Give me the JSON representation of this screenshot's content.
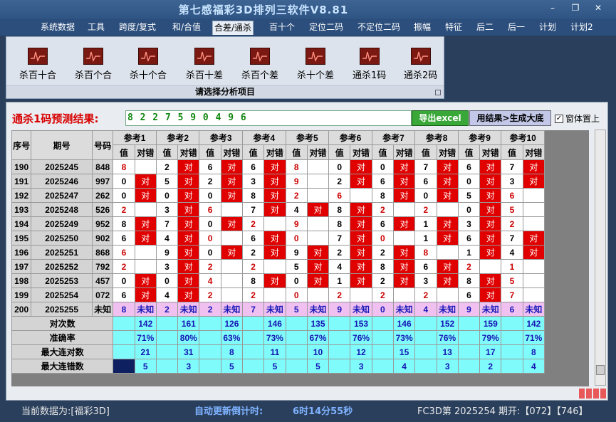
{
  "app": {
    "title": "第七感福彩3D排列三软件V8.81"
  },
  "menu": [
    "系统数据",
    "工具",
    "跨度/复式",
    "和/合值",
    "合差/通杀",
    "百十个",
    "定位二码",
    "不定位二码",
    "振幅",
    "特征",
    "后二",
    "后一",
    "计划",
    "计划2"
  ],
  "ribbon": {
    "buttons": [
      "杀百十合",
      "杀百个合",
      "杀十个合",
      "杀百十差",
      "杀百个差",
      "杀十个差",
      "通杀1码",
      "通杀2码"
    ],
    "footer": "请选择分析项目"
  },
  "prediction": {
    "label": "通杀1码预测结果:",
    "value": "8 2 2 7 5 9 0 4 9 6",
    "excel_button": "导出excel",
    "generate_button": "用结果>生成大底",
    "topmost_label": "窗体置上",
    "topmost_checked": true
  },
  "table": {
    "headers": {
      "seq": "序号",
      "period": "期号",
      "number": "号码",
      "refs": [
        "参考1",
        "参考2",
        "参考3",
        "参考4",
        "参考5",
        "参考6",
        "参考7",
        "参考8",
        "参考9",
        "参考10"
      ],
      "val": "值",
      "cmp": "对错"
    },
    "hit_label": "对",
    "rows": [
      {
        "seq": "190",
        "period": "2025245",
        "number": "848",
        "cells": [
          [
            "8",
            0
          ],
          [
            "2",
            1
          ],
          [
            "6",
            1
          ],
          [
            "6",
            1
          ],
          [
            "8",
            0
          ],
          [
            "0",
            1
          ],
          [
            "0",
            1
          ],
          [
            "7",
            1
          ],
          [
            "6",
            1
          ],
          [
            "7",
            1
          ]
        ]
      },
      {
        "seq": "191",
        "period": "2025246",
        "number": "997",
        "cells": [
          [
            "0",
            1
          ],
          [
            "5",
            1
          ],
          [
            "2",
            1
          ],
          [
            "3",
            1
          ],
          [
            "9",
            0
          ],
          [
            "2",
            1
          ],
          [
            "6",
            1
          ],
          [
            "6",
            1
          ],
          [
            "0",
            1
          ],
          [
            "3",
            1
          ]
        ]
      },
      {
        "seq": "192",
        "period": "2025247",
        "number": "262",
        "cells": [
          [
            "0",
            1
          ],
          [
            "0",
            1
          ],
          [
            "0",
            1
          ],
          [
            "8",
            1
          ],
          [
            "2",
            0
          ],
          [
            "6",
            0
          ],
          [
            "8",
            1
          ],
          [
            "0",
            1
          ],
          [
            "5",
            1
          ],
          [
            "6",
            0
          ]
        ]
      },
      {
        "seq": "193",
        "period": "2025248",
        "number": "526",
        "cells": [
          [
            "2",
            0
          ],
          [
            "3",
            1
          ],
          [
            "6",
            0
          ],
          [
            "7",
            1
          ],
          [
            "4",
            1
          ],
          [
            "8",
            1
          ],
          [
            "2",
            0
          ],
          [
            "2",
            0
          ],
          [
            "0",
            1
          ],
          [
            "5",
            0
          ]
        ]
      },
      {
        "seq": "194",
        "period": "2025249",
        "number": "952",
        "cells": [
          [
            "8",
            1
          ],
          [
            "7",
            1
          ],
          [
            "0",
            1
          ],
          [
            "2",
            0
          ],
          [
            "9",
            0
          ],
          [
            "8",
            1
          ],
          [
            "6",
            1
          ],
          [
            "1",
            1
          ],
          [
            "3",
            1
          ],
          [
            "2",
            0
          ]
        ]
      },
      {
        "seq": "195",
        "period": "2025250",
        "number": "902",
        "cells": [
          [
            "6",
            1
          ],
          [
            "4",
            1
          ],
          [
            "0",
            0
          ],
          [
            "6",
            1
          ],
          [
            "0",
            0
          ],
          [
            "7",
            1
          ],
          [
            "0",
            0
          ],
          [
            "1",
            1
          ],
          [
            "6",
            1
          ],
          [
            "7",
            1
          ]
        ]
      },
      {
        "seq": "196",
        "period": "2025251",
        "number": "868",
        "cells": [
          [
            "6",
            0
          ],
          [
            "9",
            1
          ],
          [
            "0",
            1
          ],
          [
            "2",
            1
          ],
          [
            "9",
            1
          ],
          [
            "2",
            1
          ],
          [
            "2",
            1
          ],
          [
            "8",
            0
          ],
          [
            "1",
            1
          ],
          [
            "4",
            1
          ]
        ]
      },
      {
        "seq": "197",
        "period": "2025252",
        "number": "792",
        "cells": [
          [
            "2",
            0
          ],
          [
            "3",
            1
          ],
          [
            "2",
            0
          ],
          [
            "2",
            0
          ],
          [
            "5",
            1
          ],
          [
            "4",
            1
          ],
          [
            "8",
            1
          ],
          [
            "6",
            1
          ],
          [
            "2",
            0
          ],
          [
            "1",
            0
          ]
        ]
      },
      {
        "seq": "198",
        "period": "2025253",
        "number": "457",
        "cells": [
          [
            "0",
            1
          ],
          [
            "0",
            1
          ],
          [
            "4",
            0
          ],
          [
            "8",
            1
          ],
          [
            "0",
            1
          ],
          [
            "1",
            1
          ],
          [
            "2",
            1
          ],
          [
            "3",
            1
          ],
          [
            "8",
            1
          ],
          [
            "5",
            0
          ]
        ]
      },
      {
        "seq": "199",
        "period": "2025254",
        "number": "072",
        "cells": [
          [
            "6",
            1
          ],
          [
            "4",
            1
          ],
          [
            "2",
            0
          ],
          [
            "2",
            0
          ],
          [
            "0",
            0
          ],
          [
            "2",
            0
          ],
          [
            "2",
            0
          ],
          [
            "2",
            0
          ],
          [
            "6",
            1
          ],
          [
            "7",
            0
          ]
        ]
      }
    ],
    "pending": {
      "seq": "200",
      "period": "2025255",
      "number": "未知",
      "values": [
        "8",
        "2",
        "2",
        "7",
        "5",
        "9",
        "0",
        "4",
        "9",
        "6"
      ],
      "unknown": "未知"
    },
    "summary": [
      {
        "label": "对次数",
        "values": [
          "142",
          "161",
          "126",
          "146",
          "135",
          "153",
          "146",
          "152",
          "159",
          "142"
        ]
      },
      {
        "label": "准确率",
        "values": [
          "71%",
          "80%",
          "63%",
          "73%",
          "67%",
          "76%",
          "73%",
          "76%",
          "79%",
          "71%"
        ]
      },
      {
        "label": "最大连对数",
        "values": [
          "21",
          "31",
          "8",
          "11",
          "10",
          "12",
          "15",
          "13",
          "17",
          "8"
        ]
      },
      {
        "label": "最大连错数",
        "values": [
          "5",
          "3",
          "5",
          "5",
          "5",
          "3",
          "4",
          "3",
          "2",
          "4"
        ]
      }
    ]
  },
  "status": {
    "current_data": "当前数据为:[福彩3D]",
    "countdown_label": "自动更新倒计时:",
    "countdown_value": "6时14分55秒",
    "draw_info": "FC3D第 2025254 期开:【072】【746】"
  },
  "colors": {
    "hit": "#e00000",
    "pending_row": "#f0c0f0",
    "summary": "#80fbfb",
    "prediction_label": "#d80000"
  }
}
